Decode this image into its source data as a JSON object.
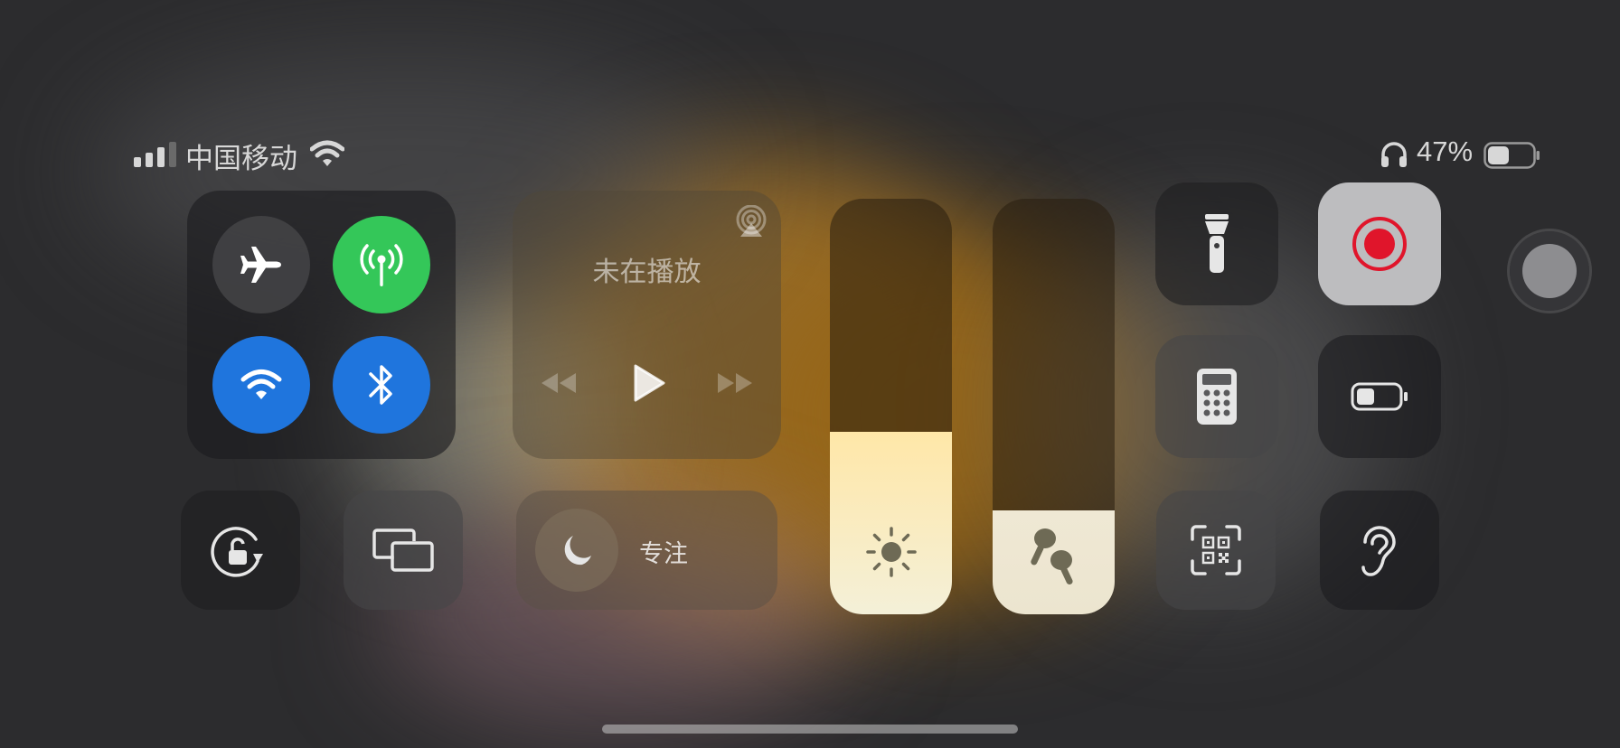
{
  "status_bar": {
    "carrier": "中国移动",
    "battery_percent": "47%",
    "battery_level": 0.47,
    "signal_bars": 3
  },
  "connectivity": {
    "airplane": {
      "icon": "airplane-icon",
      "on": false
    },
    "cellular": {
      "icon": "cellular-antenna-icon",
      "on": true,
      "color": "#34c759"
    },
    "wifi": {
      "icon": "wifi-icon",
      "on": true,
      "color": "#0a84ff"
    },
    "bluetooth": {
      "icon": "bluetooth-icon",
      "on": true,
      "color": "#0a84ff"
    }
  },
  "now_playing": {
    "status_label": "未在播放",
    "airplay_icon": "airplay-icon",
    "controls": [
      "rewind-icon",
      "play-icon",
      "fast-forward-icon"
    ]
  },
  "focus": {
    "label": "专注",
    "icon": "moon-icon"
  },
  "brightness_level": 0.44,
  "volume_level": 0.25,
  "tiles": {
    "rotation_lock": "rotation-lock-icon",
    "screen_mirroring": "screen-mirroring-icon",
    "flashlight": "flashlight-icon",
    "screen_recording": {
      "icon": "record-icon",
      "color": "#e0152b"
    },
    "calculator": "calculator-icon",
    "low_power": "battery-icon",
    "code_scanner": "qr-scanner-icon",
    "hearing": "ear-icon"
  },
  "colors": {
    "green": "#34c759",
    "blue": "#1f75dd",
    "record_red": "#e0152b"
  }
}
